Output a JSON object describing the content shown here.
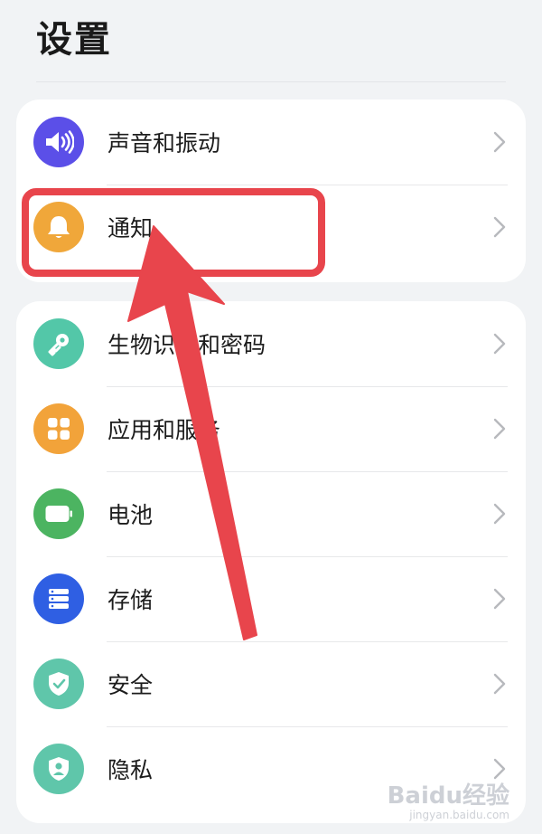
{
  "page": {
    "title": "设置"
  },
  "groups": [
    {
      "items": [
        {
          "label": "声音和振动",
          "icon": "speaker-icon",
          "color": "#5b4fe8"
        },
        {
          "label": "通知",
          "icon": "bell-icon",
          "color": "#f0a73a"
        }
      ]
    },
    {
      "items": [
        {
          "label": "生物识别和密码",
          "icon": "key-icon",
          "color": "#53c7a8"
        },
        {
          "label": "应用和服务",
          "icon": "apps-grid-icon",
          "color": "#f2a33a"
        },
        {
          "label": "电池",
          "icon": "battery-icon",
          "color": "#4cb461"
        },
        {
          "label": "存储",
          "icon": "storage-icon",
          "color": "#2f5fe3"
        },
        {
          "label": "安全",
          "icon": "shield-icon",
          "color": "#5fc6aa"
        },
        {
          "label": "隐私",
          "icon": "privacy-user-icon",
          "color": "#5fc6aa"
        }
      ]
    }
  ],
  "annotation": {
    "color": "#e8454c",
    "highlighted_item": "通知"
  },
  "watermark": {
    "main": "Baidu经验",
    "sub": "jingyan.baidu.com"
  }
}
